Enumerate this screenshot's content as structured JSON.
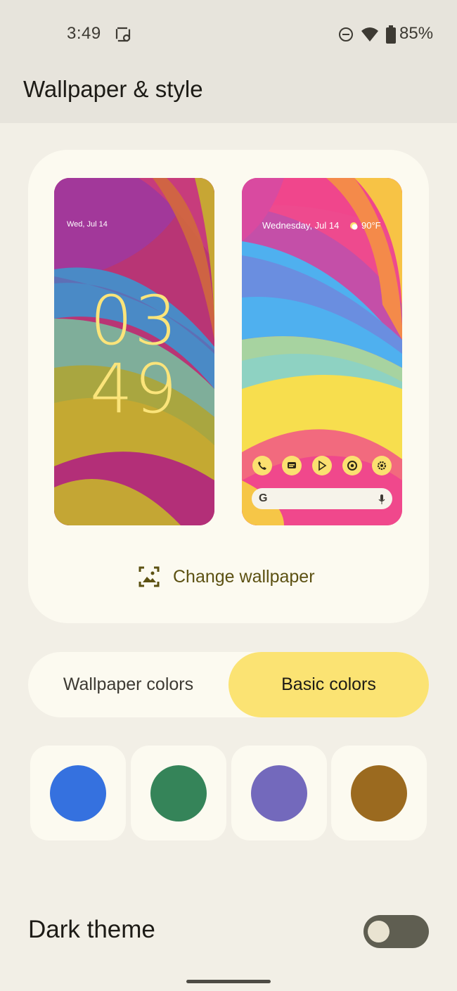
{
  "status_bar": {
    "time": "3:49",
    "battery": "85%",
    "icons": [
      "screenshot-icon",
      "do-not-disturb-icon",
      "wifi-icon",
      "battery-icon"
    ]
  },
  "app_bar": {
    "title": "Wallpaper & style"
  },
  "preview": {
    "lock_screen": {
      "date": "Wed, Jul 14",
      "clock_hours": "03",
      "clock_minutes": "49"
    },
    "home_screen": {
      "date": "Wednesday, Jul 14",
      "temperature": "90°F",
      "dock_icons": [
        "phone-icon",
        "messages-icon",
        "play-store-icon",
        "chrome-icon",
        "settings-icon"
      ],
      "search_logo": "G"
    },
    "change_wallpaper_label": "Change wallpaper"
  },
  "tabs": [
    {
      "label": "Wallpaper colors",
      "selected": false
    },
    {
      "label": "Basic colors",
      "selected": true
    }
  ],
  "swatches": [
    {
      "name": "blue",
      "color": "#3571df"
    },
    {
      "name": "green",
      "color": "#358459"
    },
    {
      "name": "purple",
      "color": "#7369bc"
    },
    {
      "name": "brown",
      "color": "#9b6a1f"
    }
  ],
  "dark_theme": {
    "label": "Dark theme",
    "enabled": false
  },
  "colors": {
    "accent": "#fbe373",
    "background": "#f2efe6",
    "card": "#fcfaf0"
  }
}
